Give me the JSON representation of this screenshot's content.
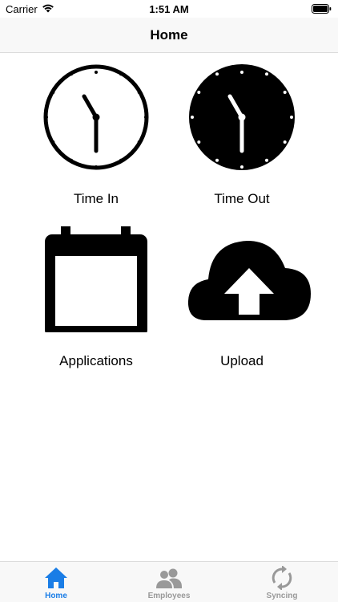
{
  "status_bar": {
    "carrier": "Carrier",
    "time": "1:51 AM"
  },
  "nav": {
    "title": "Home"
  },
  "grid": {
    "time_in": {
      "label": "Time In",
      "icon": "clock-icon"
    },
    "time_out": {
      "label": "Time Out",
      "icon": "clock-filled-icon"
    },
    "applications": {
      "label": "Applications",
      "icon": "calendar-icon"
    },
    "upload": {
      "label": "Upload",
      "icon": "cloud-upload-icon"
    }
  },
  "tabs": [
    {
      "label": "Home",
      "icon": "home-icon",
      "selected": true
    },
    {
      "label": "Employees",
      "icon": "people-icon",
      "selected": false
    },
    {
      "label": "Syncing",
      "icon": "sync-icon",
      "selected": false
    }
  ],
  "colors": {
    "accent": "#1a7de6",
    "inactive": "#999999"
  }
}
